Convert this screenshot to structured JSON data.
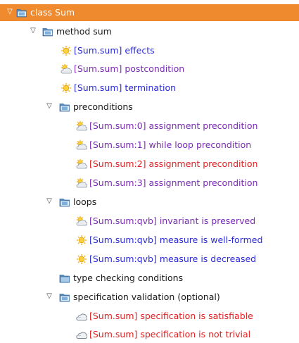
{
  "colors": {
    "selection": "#f08a2e",
    "folder": "#6ea1cf",
    "verified_blue": "#2a2ad6",
    "unknown_purple": "#7a2ab5",
    "failed_red": "#e02020"
  },
  "tree": {
    "root": {
      "label": "class Sum",
      "expanded": true,
      "selected": true,
      "icon": "class-folder-icon"
    },
    "method": {
      "label": "method sum",
      "expanded": true,
      "icon": "method-folder-icon"
    },
    "method_items": [
      {
        "label": "[Sum.sum] effects",
        "icon": "sunny-icon"
      },
      {
        "label": "[Sum.sum] postcondition",
        "icon": "partly-cloudy-icon"
      },
      {
        "label": "[Sum.sum] termination",
        "icon": "sunny-icon"
      }
    ],
    "preconditions": {
      "label": "preconditions",
      "expanded": true,
      "icon": "folder-icon",
      "items": [
        {
          "label": "[Sum.sum:0] assignment precondition",
          "icon": "partly-cloudy-icon"
        },
        {
          "label": "[Sum.sum:1] while loop precondition",
          "icon": "partly-cloudy-icon"
        },
        {
          "label": "[Sum.sum:2] assignment precondition",
          "icon": "partly-cloudy-icon"
        },
        {
          "label": "[Sum.sum:3] assignment precondition",
          "icon": "partly-cloudy-icon"
        }
      ]
    },
    "loops": {
      "label": "loops",
      "expanded": true,
      "icon": "folder-icon",
      "items": [
        {
          "label": "[Sum.sum:qvb] invariant is preserved",
          "icon": "partly-cloudy-icon"
        },
        {
          "label": "[Sum.sum:qvb] measure is well-formed",
          "icon": "sunny-icon"
        },
        {
          "label": "[Sum.sum:qvb] measure is decreased",
          "icon": "sunny-icon"
        }
      ]
    },
    "type_checking": {
      "label": "type checking conditions",
      "icon": "folder-icon"
    },
    "spec_validation": {
      "label": "specification validation (optional)",
      "expanded": true,
      "icon": "folder-icon",
      "items": [
        {
          "label": "[Sum.sum] specification is satisfiable",
          "icon": "cloudy-icon"
        },
        {
          "label": "[Sum.sum] specification is not trivial",
          "icon": "cloudy-icon"
        }
      ]
    }
  }
}
